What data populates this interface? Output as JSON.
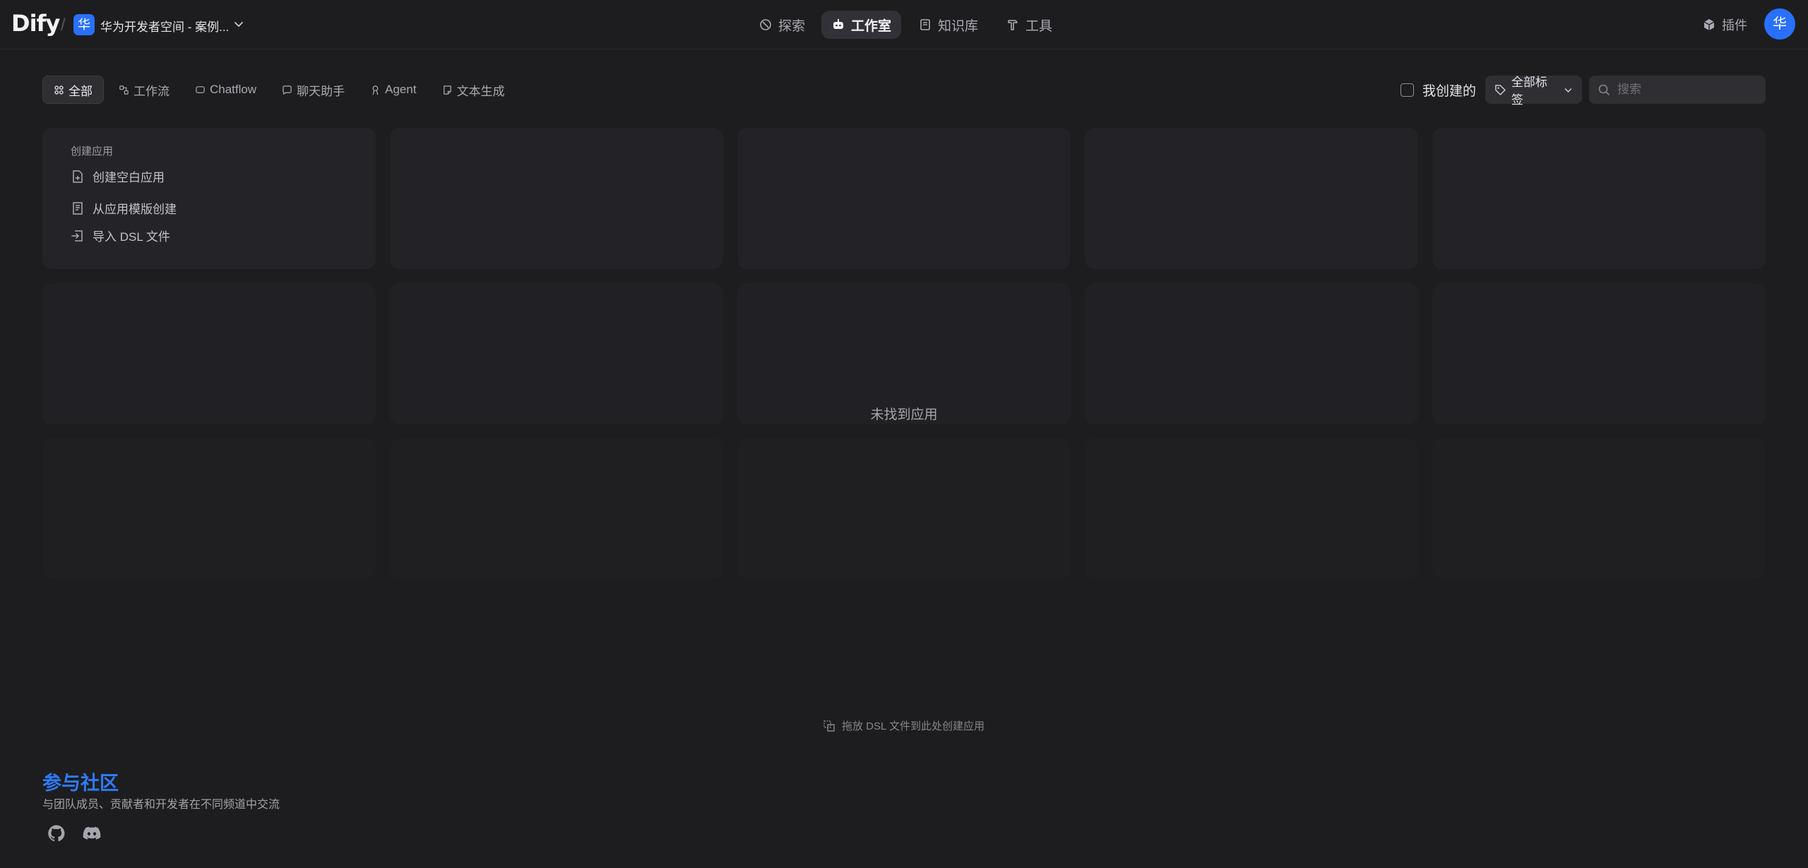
{
  "brand": {
    "logo": "Dify",
    "separator": "/"
  },
  "workspace": {
    "badge": "华",
    "name": "华为开发者空间 - 案例..."
  },
  "nav": {
    "explore": "探索",
    "studio": "工作室",
    "knowledge": "知识库",
    "tools": "工具"
  },
  "header_right": {
    "plugins": "插件",
    "avatar": "华"
  },
  "filters": {
    "tabs": [
      "全部",
      "工作流",
      "Chatflow",
      "聊天助手",
      "Agent",
      "文本生成"
    ],
    "active_tab": "全部",
    "created_by_me": "我创建的",
    "tags": "全部标签",
    "search_placeholder": "搜索"
  },
  "create_card": {
    "title": "创建应用",
    "items": [
      "创建空白应用",
      "从应用模版创建",
      "导入 DSL 文件"
    ]
  },
  "empty_state": "未找到应用",
  "dropzone": "拖放 DSL 文件到此处创建应用",
  "community": {
    "title": "参与社区",
    "description": "与团队成员、贡献者和开发者在不同频道中交流"
  },
  "colors": {
    "background": "#1d1d20",
    "accent": "#2970ff",
    "community_link": "#2e7bff"
  }
}
